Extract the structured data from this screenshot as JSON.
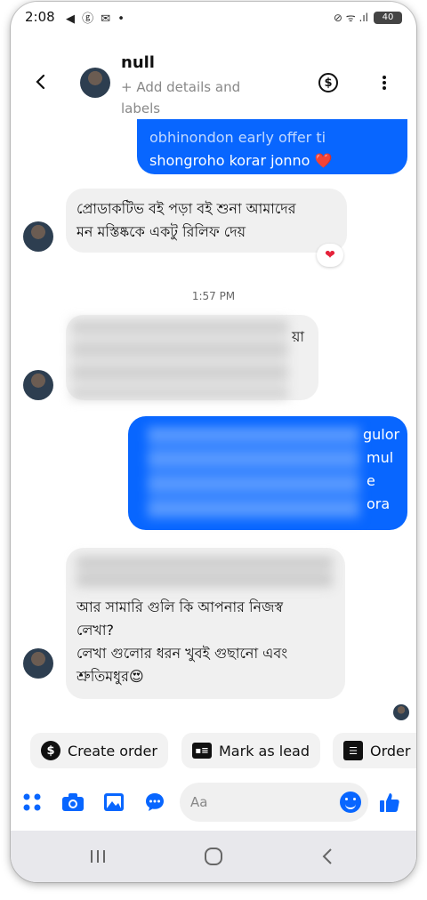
{
  "status_bar": {
    "time": "2:08",
    "left_icons": "◀ ⓖ ✉ •",
    "signal": "⊘ ᯤ .ıl",
    "battery": "40"
  },
  "header": {
    "name": "null",
    "subtitle": "+ Add details and labels"
  },
  "messages": {
    "outgoing_1": {
      "lines": [
        "obhinondon early offer ti",
        "shongroho korar jonno ❤️"
      ]
    },
    "incoming_1": {
      "lines": [
        "প্রোডাকটিভ বই পড়া বই শুনা আমাদের",
        "মন মস্তিষ্ককে একটু রিলিফ দেয়"
      ],
      "reaction": "❤"
    },
    "timestamp": "1:57 PM",
    "incoming_2": {
      "visible_fragment": "য়া"
    },
    "outgoing_2": {
      "visible_fragments": [
        "gulor",
        "mul",
        "e",
        "ora"
      ]
    },
    "incoming_3": {
      "lines": [
        "আর সামারি গুলি কি আপনার নিজস্ব",
        "লেখা?",
        "লেখা গুলোর ধরন খুবই গুছানো এবং",
        "শ্রুতিমধুর😍"
      ]
    }
  },
  "quick_actions": [
    {
      "label": "Create order",
      "icon": "dollar-icon"
    },
    {
      "label": "Mark as lead",
      "icon": "lead-card-icon"
    },
    {
      "label": "Order",
      "icon": "order-list-icon"
    }
  ],
  "composer": {
    "placeholder": "Aa"
  },
  "colors": {
    "accent": "#0866ff",
    "incoming_bubble": "#f0f0f0"
  }
}
